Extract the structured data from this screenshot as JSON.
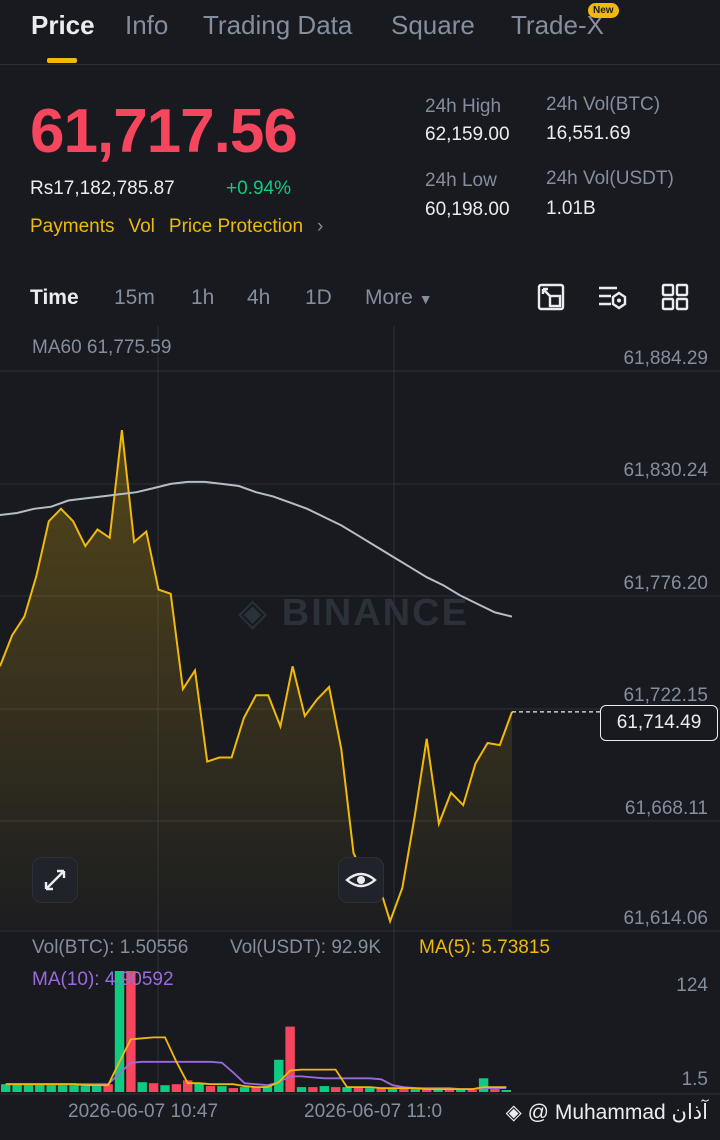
{
  "tabs": [
    {
      "label": "Price",
      "active": true
    },
    {
      "label": "Info"
    },
    {
      "label": "Trading Data"
    },
    {
      "label": "Square"
    },
    {
      "label": "Trade-X"
    }
  ],
  "new_badge": "New",
  "price": {
    "last": "61,717.56",
    "fiat": "Rs17,182,785.87",
    "change": "+0.94%"
  },
  "links": [
    "Payments",
    "Vol",
    "Price Protection"
  ],
  "stats": {
    "high_label": "24h High",
    "high_value": "62,159.00",
    "low_label": "24h Low",
    "low_value": "60,198.00",
    "vol_btc_label": "24h Vol(BTC)",
    "vol_btc_value": "16,551.69",
    "vol_usdt_label": "24h Vol(USDT)",
    "vol_usdt_value": "1.01B"
  },
  "intervals": [
    "Time",
    "15m",
    "1h",
    "4h",
    "1D",
    "More"
  ],
  "toolbar_icons": [
    "compare-icon",
    "indicator-settings-icon",
    "grid-layout-icon"
  ],
  "chart_legend": {
    "ma60": "MA60 61,775.59"
  },
  "y_ticks": [
    "61,884.29",
    "61,830.24",
    "61,776.20",
    "61,722.15",
    "61,668.11",
    "61,614.06"
  ],
  "current_price_tag": "61,714.49",
  "watermark": "BINANCE",
  "volume_legend": {
    "vol_btc": "Vol(BTC): 1.50556",
    "vol_usdt": "Vol(USDT): 92.9K",
    "ma5": "MA(5): 5.73815",
    "ma10": "MA(10): 4.90592"
  },
  "volume_ticks": [
    "124",
    "1.5"
  ],
  "time_labels": [
    "2026-06-07 10:47",
    "2026-06-07 11:0"
  ],
  "credit": "@ Muhammad آذان",
  "colors": {
    "up": "#0ecb81",
    "down": "#f6465d",
    "accent": "#f0b90b",
    "ma10": "#9c6ade",
    "ma60": "#b7bdc6"
  },
  "chart_data": {
    "type": "area",
    "ylim": [
      61614.06,
      61884.29
    ],
    "price": [
      61736,
      61751,
      61760,
      61780,
      61806,
      61812,
      61806,
      61794,
      61802,
      61798,
      61850,
      61796,
      61801,
      61773,
      61771,
      61725,
      61734,
      61690,
      61692,
      61692,
      61711,
      61722,
      61722,
      61707,
      61736,
      61712,
      61720,
      61726,
      61696,
      61646,
      61633,
      61632,
      61613,
      61629,
      61663,
      61701,
      61660,
      61675,
      61669,
      61689,
      61699,
      61698,
      61714
    ],
    "ma60": [
      61809,
      61810,
      61812,
      61813,
      61816,
      61817,
      61818,
      61819,
      61820,
      61822,
      61824,
      61825,
      61825,
      61824,
      61823,
      61820,
      61818,
      61815,
      61812,
      61808,
      61804,
      61799,
      61794,
      61789,
      61784,
      61779,
      61775,
      61770,
      61766,
      61762,
      61760
    ],
    "volume": {
      "values": [
        8,
        8,
        8,
        8,
        7,
        7,
        7,
        6,
        6,
        8,
        124,
        124,
        10,
        9,
        7,
        8,
        12,
        9,
        6,
        6,
        4,
        5,
        5,
        6,
        33,
        67,
        5,
        5,
        6,
        5,
        5,
        5,
        4,
        4,
        4,
        4,
        3,
        3,
        2,
        2,
        3,
        2,
        14,
        3,
        2
      ],
      "up": [
        true,
        true,
        true,
        true,
        true,
        true,
        true,
        true,
        true,
        false,
        true,
        false,
        true,
        false,
        true,
        false,
        false,
        true,
        false,
        true,
        false,
        true,
        false,
        true,
        true,
        false,
        true,
        false,
        true,
        false,
        true,
        false,
        true,
        false,
        true,
        false,
        true,
        false,
        true,
        false,
        true,
        false,
        true,
        false,
        true
      ],
      "ma5": [
        8,
        8,
        8,
        8,
        8,
        8,
        8,
        7,
        7,
        7,
        31,
        54,
        55,
        56,
        56,
        31,
        9,
        9,
        8,
        8,
        8,
        6,
        5,
        5,
        10,
        22,
        23,
        23,
        23,
        23,
        5,
        5,
        5,
        4,
        4,
        4,
        4,
        3,
        3,
        3,
        3,
        3,
        5,
        5,
        5
      ],
      "ma10": [
        8,
        8,
        8,
        8,
        8,
        8,
        8,
        8,
        8,
        8,
        19,
        30,
        31,
        31,
        31,
        31,
        31,
        31,
        31,
        30,
        20,
        9,
        8,
        7,
        10,
        16,
        16,
        15,
        14,
        14,
        14,
        14,
        14,
        13,
        7,
        5,
        4,
        4,
        4,
        4,
        3,
        3,
        4,
        4,
        4
      ]
    }
  }
}
